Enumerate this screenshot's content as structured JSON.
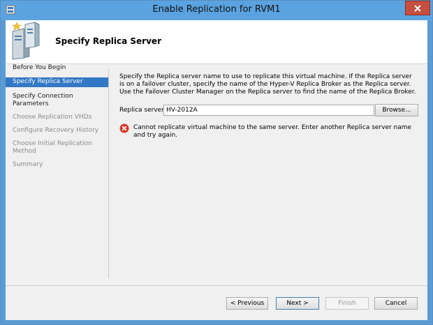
{
  "window": {
    "title": "Enable Replication for RVM1"
  },
  "header": {
    "title": "Specify Replica Server"
  },
  "nav": {
    "items": [
      {
        "label": "Before You Begin",
        "state": "normal"
      },
      {
        "label": "Specify Replica Server",
        "state": "active"
      },
      {
        "label": "Specify Connection Parameters",
        "state": "normal"
      },
      {
        "label": "Choose Replication VHDs",
        "state": "disabled"
      },
      {
        "label": "Configure Recovery History",
        "state": "disabled"
      },
      {
        "label": "Choose Initial Replication Method",
        "state": "disabled"
      },
      {
        "label": "Summary",
        "state": "disabled"
      }
    ]
  },
  "main": {
    "description": "Specify the Replica server name to use to replicate this virtual machine. If the Replica server is on a failover cluster, specify the name of the Hyper-V Replica Broker as the Replica server. Use the Failover Cluster Manager on the Replica server to find the name of the Replica Broker.",
    "replica_label": "Replica server:",
    "replica_value": "HV-2012A",
    "browse_label": "Browse...",
    "error_text": "Cannot replicate virtual machine to the same server. Enter another Replica server name and try again."
  },
  "footer": {
    "previous_label": "< Previous",
    "next_label": "Next >",
    "finish_label": "Finish",
    "cancel_label": "Cancel"
  },
  "colors": {
    "titlebar": "#5ba3e0",
    "close_button": "#c74f3f",
    "nav_active": "#3378c4",
    "error_icon": "#d9372b"
  },
  "icons": {
    "app": "hyper-v-icon",
    "wizard": "server-wizard-icon",
    "close": "close-icon",
    "error": "error-icon"
  }
}
